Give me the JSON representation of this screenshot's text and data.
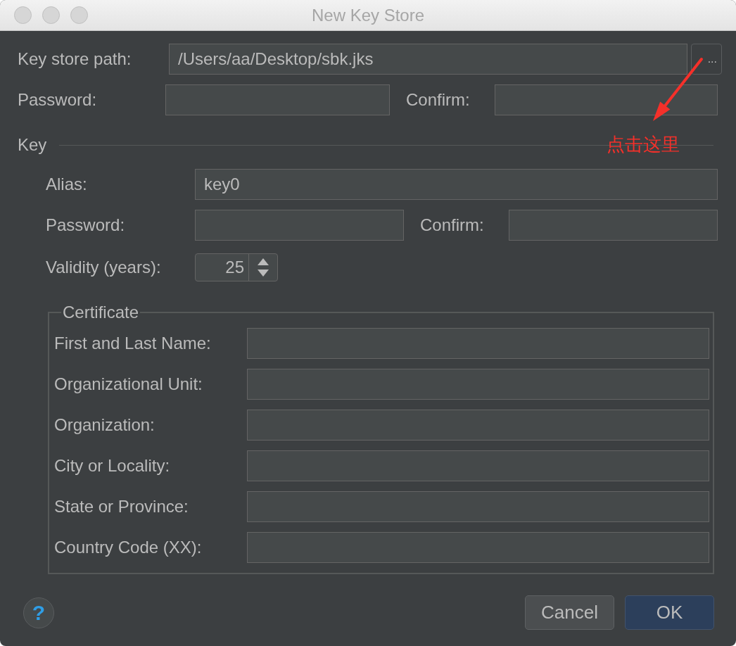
{
  "window": {
    "title": "New Key Store"
  },
  "key_store": {
    "path_label": "Key store path:",
    "path_value": "/Users/aa/Desktop/sbk.jks",
    "browse_button": "...",
    "password_label": "Password:",
    "confirm_label": "Confirm:"
  },
  "key": {
    "heading": "Key",
    "alias_label": "Alias:",
    "alias_value": "key0",
    "password_label": "Password:",
    "confirm_label": "Confirm:",
    "validity_label": "Validity (years):",
    "validity_value": "25"
  },
  "certificate": {
    "title": "Certificate",
    "fields": [
      {
        "label": "First and Last Name:"
      },
      {
        "label": "Organizational Unit:"
      },
      {
        "label": "Organization:"
      },
      {
        "label": "City or Locality:"
      },
      {
        "label": "State or Province:"
      },
      {
        "label": "Country Code (XX):"
      }
    ]
  },
  "annotation": {
    "text": "点击这里"
  },
  "buttons": {
    "help": "?",
    "cancel": "Cancel",
    "ok": "OK"
  }
}
